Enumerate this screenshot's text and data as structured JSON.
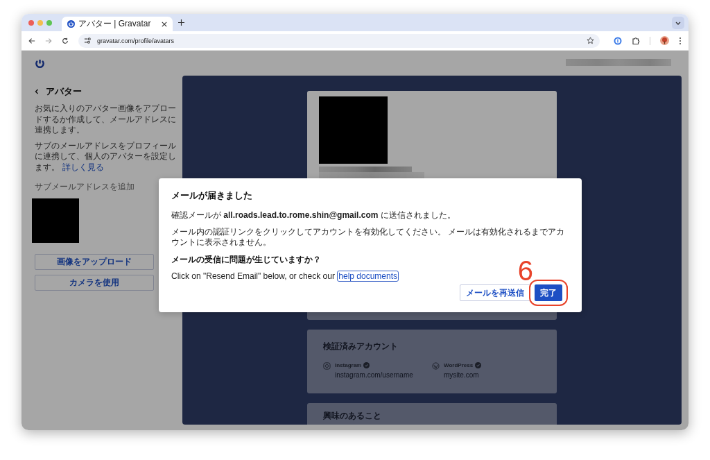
{
  "browser": {
    "tabs": [
      {
        "title": "アバター | Gravatar",
        "selected": true
      }
    ],
    "address": "gravatar.com/profile/avatars"
  },
  "sidebar": {
    "title": "アバター",
    "paragraphs": [
      {
        "text": "お気に入りのアバター画像をアプロードするか作成して、メールアドレスに連携します。"
      },
      {
        "text": "サブのメールアドレスをプロフィールに連携して、個人のアバターを設定します。",
        "link": "詳しく見る"
      }
    ],
    "add_email": "サブメールアドレスを追加",
    "buttons": [
      "画像をアップロード",
      "カメラを使用"
    ]
  },
  "profile": {
    "verified": {
      "title": "検証済みアカウント",
      "accounts": [
        {
          "kind": "instagram",
          "name": "Instagram",
          "url": "instagram.com/username",
          "verified": true
        },
        {
          "kind": "wordpress",
          "name": "WordPress",
          "url": "mysite.com",
          "verified": true
        }
      ]
    },
    "interests": {
      "title": "興味のあること"
    }
  },
  "dialog": {
    "title": "メールが届きました",
    "paragraphs": [
      "確認メールが **all.roads.lead.to.rome.shin@gmail.com** に送信されました。",
      "メール内の認証リンクをクリックしてアカウントを有効化してください。 メールは有効化されるまでアカウントに表示されません。"
    ],
    "question": "メールの受信に問題が生じていますか？",
    "help_text": "Click on \"Resend Email\" below, or check our",
    "help_link": "help documents",
    "buttons": [
      {
        "label": "メールを再送信",
        "kind": "secondary"
      },
      {
        "label": "完了",
        "kind": "primary"
      }
    ]
  },
  "annotation": {
    "step": "6",
    "ring": true
  }
}
